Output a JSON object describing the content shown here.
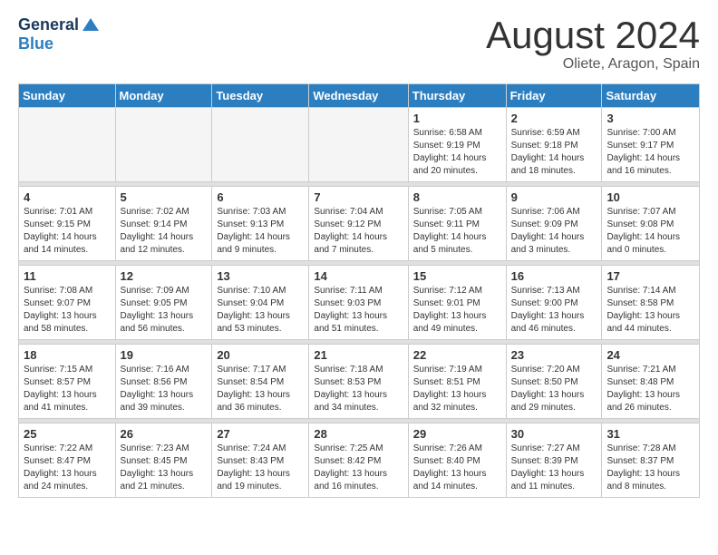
{
  "header": {
    "logo_general": "General",
    "logo_blue": "Blue",
    "title": "August 2024",
    "location": "Oliete, Aragon, Spain"
  },
  "weekdays": [
    "Sunday",
    "Monday",
    "Tuesday",
    "Wednesday",
    "Thursday",
    "Friday",
    "Saturday"
  ],
  "weeks": [
    [
      {
        "day": "",
        "content": ""
      },
      {
        "day": "",
        "content": ""
      },
      {
        "day": "",
        "content": ""
      },
      {
        "day": "",
        "content": ""
      },
      {
        "day": "1",
        "content": "Sunrise: 6:58 AM\nSunset: 9:19 PM\nDaylight: 14 hours\nand 20 minutes."
      },
      {
        "day": "2",
        "content": "Sunrise: 6:59 AM\nSunset: 9:18 PM\nDaylight: 14 hours\nand 18 minutes."
      },
      {
        "day": "3",
        "content": "Sunrise: 7:00 AM\nSunset: 9:17 PM\nDaylight: 14 hours\nand 16 minutes."
      }
    ],
    [
      {
        "day": "4",
        "content": "Sunrise: 7:01 AM\nSunset: 9:15 PM\nDaylight: 14 hours\nand 14 minutes."
      },
      {
        "day": "5",
        "content": "Sunrise: 7:02 AM\nSunset: 9:14 PM\nDaylight: 14 hours\nand 12 minutes."
      },
      {
        "day": "6",
        "content": "Sunrise: 7:03 AM\nSunset: 9:13 PM\nDaylight: 14 hours\nand 9 minutes."
      },
      {
        "day": "7",
        "content": "Sunrise: 7:04 AM\nSunset: 9:12 PM\nDaylight: 14 hours\nand 7 minutes."
      },
      {
        "day": "8",
        "content": "Sunrise: 7:05 AM\nSunset: 9:11 PM\nDaylight: 14 hours\nand 5 minutes."
      },
      {
        "day": "9",
        "content": "Sunrise: 7:06 AM\nSunset: 9:09 PM\nDaylight: 14 hours\nand 3 minutes."
      },
      {
        "day": "10",
        "content": "Sunrise: 7:07 AM\nSunset: 9:08 PM\nDaylight: 14 hours\nand 0 minutes."
      }
    ],
    [
      {
        "day": "11",
        "content": "Sunrise: 7:08 AM\nSunset: 9:07 PM\nDaylight: 13 hours\nand 58 minutes."
      },
      {
        "day": "12",
        "content": "Sunrise: 7:09 AM\nSunset: 9:05 PM\nDaylight: 13 hours\nand 56 minutes."
      },
      {
        "day": "13",
        "content": "Sunrise: 7:10 AM\nSunset: 9:04 PM\nDaylight: 13 hours\nand 53 minutes."
      },
      {
        "day": "14",
        "content": "Sunrise: 7:11 AM\nSunset: 9:03 PM\nDaylight: 13 hours\nand 51 minutes."
      },
      {
        "day": "15",
        "content": "Sunrise: 7:12 AM\nSunset: 9:01 PM\nDaylight: 13 hours\nand 49 minutes."
      },
      {
        "day": "16",
        "content": "Sunrise: 7:13 AM\nSunset: 9:00 PM\nDaylight: 13 hours\nand 46 minutes."
      },
      {
        "day": "17",
        "content": "Sunrise: 7:14 AM\nSunset: 8:58 PM\nDaylight: 13 hours\nand 44 minutes."
      }
    ],
    [
      {
        "day": "18",
        "content": "Sunrise: 7:15 AM\nSunset: 8:57 PM\nDaylight: 13 hours\nand 41 minutes."
      },
      {
        "day": "19",
        "content": "Sunrise: 7:16 AM\nSunset: 8:56 PM\nDaylight: 13 hours\nand 39 minutes."
      },
      {
        "day": "20",
        "content": "Sunrise: 7:17 AM\nSunset: 8:54 PM\nDaylight: 13 hours\nand 36 minutes."
      },
      {
        "day": "21",
        "content": "Sunrise: 7:18 AM\nSunset: 8:53 PM\nDaylight: 13 hours\nand 34 minutes."
      },
      {
        "day": "22",
        "content": "Sunrise: 7:19 AM\nSunset: 8:51 PM\nDaylight: 13 hours\nand 32 minutes."
      },
      {
        "day": "23",
        "content": "Sunrise: 7:20 AM\nSunset: 8:50 PM\nDaylight: 13 hours\nand 29 minutes."
      },
      {
        "day": "24",
        "content": "Sunrise: 7:21 AM\nSunset: 8:48 PM\nDaylight: 13 hours\nand 26 minutes."
      }
    ],
    [
      {
        "day": "25",
        "content": "Sunrise: 7:22 AM\nSunset: 8:47 PM\nDaylight: 13 hours\nand 24 minutes."
      },
      {
        "day": "26",
        "content": "Sunrise: 7:23 AM\nSunset: 8:45 PM\nDaylight: 13 hours\nand 21 minutes."
      },
      {
        "day": "27",
        "content": "Sunrise: 7:24 AM\nSunset: 8:43 PM\nDaylight: 13 hours\nand 19 minutes."
      },
      {
        "day": "28",
        "content": "Sunrise: 7:25 AM\nSunset: 8:42 PM\nDaylight: 13 hours\nand 16 minutes."
      },
      {
        "day": "29",
        "content": "Sunrise: 7:26 AM\nSunset: 8:40 PM\nDaylight: 13 hours\nand 14 minutes."
      },
      {
        "day": "30",
        "content": "Sunrise: 7:27 AM\nSunset: 8:39 PM\nDaylight: 13 hours\nand 11 minutes."
      },
      {
        "day": "31",
        "content": "Sunrise: 7:28 AM\nSunset: 8:37 PM\nDaylight: 13 hours\nand 8 minutes."
      }
    ]
  ]
}
